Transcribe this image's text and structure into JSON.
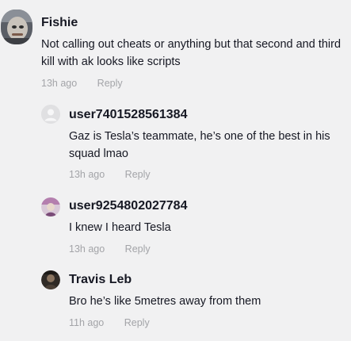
{
  "comments": [
    {
      "username": "Fishie",
      "text": "Not calling out cheats or anything but that second and third kill with ak looks like scripts",
      "time": "13h ago",
      "reply_label": "Reply",
      "avatar_icon": "user-photo-avatar"
    },
    {
      "username": "user7401528561384",
      "text": "Gaz is Tesla’s teammate, he’s one of the best in his squad lmao",
      "time": "13h ago",
      "reply_label": "Reply",
      "avatar_icon": "default-avatar"
    },
    {
      "username": "user9254802027784",
      "text": "I knew I heard Tesla",
      "time": "13h ago",
      "reply_label": "Reply",
      "avatar_icon": "user-photo-avatar"
    },
    {
      "username": "Travis Leb",
      "text": "Bro he’s like 5metres away from them",
      "time": "11h ago",
      "reply_label": "Reply",
      "avatar_icon": "user-photo-avatar"
    }
  ]
}
